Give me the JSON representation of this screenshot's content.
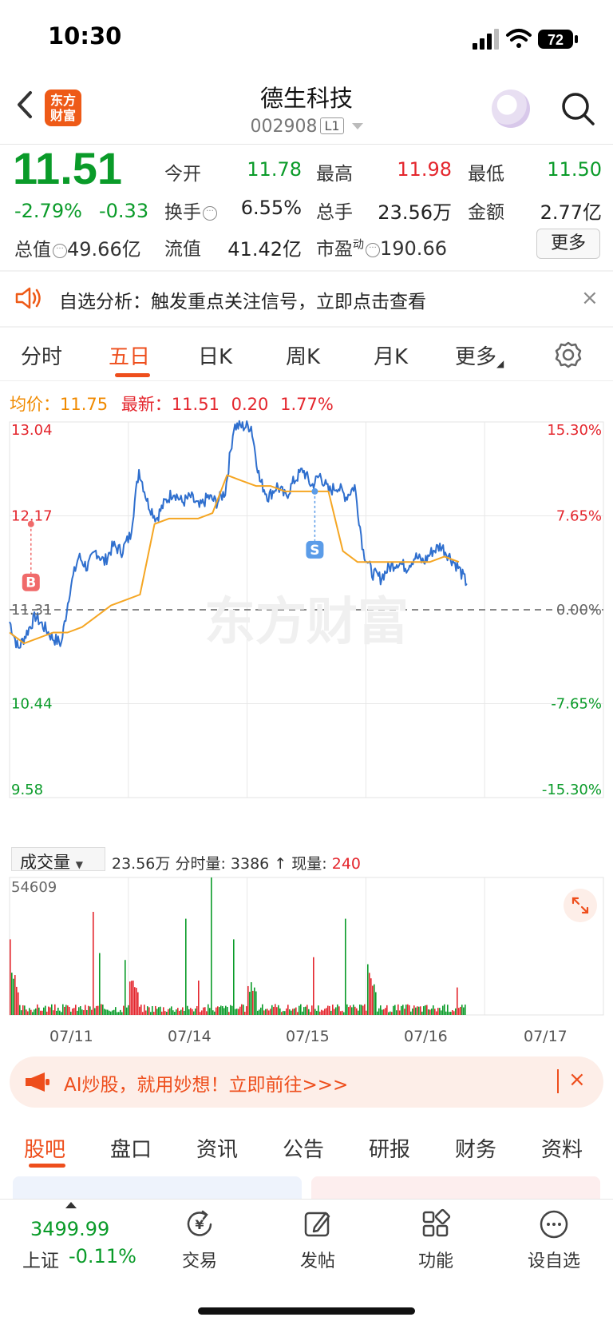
{
  "status": {
    "time": "10:30",
    "battery": "72"
  },
  "header": {
    "logo_line1": "东方",
    "logo_line2": "财富",
    "stock_name": "德生科技",
    "stock_code": "002908",
    "level": "L1"
  },
  "quote": {
    "price": "11.51",
    "chg_pct": "-2.79%",
    "chg_abs": "-0.33",
    "open_label": "今开",
    "open": "11.78",
    "high_label": "最高",
    "high": "11.98",
    "low_label": "最低",
    "low": "11.50",
    "turnover_label": "换手",
    "turnover": "6.55%",
    "volume_label": "总手",
    "volume": "23.56万",
    "amount_label": "金额",
    "amount": "2.77亿",
    "total_mv_label": "总值",
    "total_mv": "49.66亿",
    "float_mv_label": "流值",
    "float_mv": "41.42亿",
    "pe_label": "市盈",
    "pe_sup": "动",
    "pe": "190.66",
    "more": "更多"
  },
  "alert": {
    "text": "自选分析：触发重点关注信号，立即点击查看",
    "close": "×"
  },
  "period_tabs": [
    "分时",
    "五日",
    "日K",
    "周K",
    "月K",
    "更多"
  ],
  "legend": {
    "avg_label": "均价：",
    "avg": "11.75",
    "latest_label": "最新：",
    "latest": "11.51",
    "chg": "0.20",
    "chg_pct": "1.77%"
  },
  "chart_data": [
    {
      "type": "line",
      "title": "",
      "days": [
        "07/11",
        "07/14",
        "07/15",
        "07/16",
        "07/17"
      ],
      "ylim": [
        9.58,
        13.04
      ],
      "y_ticks": [
        "13.04",
        "12.17",
        "11.31",
        "10.44",
        "9.58"
      ],
      "pct_ticks": [
        "15.30%",
        "7.65%",
        "0.00%",
        "-7.65%",
        "-15.30%"
      ],
      "pre_close": 11.31,
      "series": [
        {
          "name": "",
          "values": [
            11.2,
            10.95,
            11.1,
            11.25,
            11.15,
            11.05,
            11.0,
            11.5,
            11.8,
            11.7,
            11.85,
            11.75,
            11.9,
            11.85,
            12.0,
            12.6,
            12.3,
            12.15,
            12.3,
            12.4,
            12.3,
            12.35,
            12.25,
            12.35,
            12.3,
            12.4,
            13.0,
            13.0,
            13.0,
            12.5,
            12.35,
            12.45,
            12.35,
            12.5,
            12.6,
            12.45,
            12.55,
            12.4,
            12.45,
            12.35,
            12.45,
            11.85,
            11.65,
            11.6,
            11.7,
            11.75,
            11.7,
            11.8,
            11.75,
            11.85,
            11.9,
            11.8,
            11.7,
            11.55
          ]
        },
        {
          "name": "",
          "values": [
            11.1,
            11.0,
            11.05,
            11.1,
            11.1,
            11.15,
            11.25,
            11.35,
            11.4,
            11.45,
            12.1,
            12.15,
            12.15,
            12.15,
            12.2,
            12.55,
            12.5,
            12.45,
            12.45,
            12.4,
            12.4,
            12.4,
            12.4,
            11.85,
            11.75,
            11.75,
            11.75,
            11.75,
            11.75,
            11.75,
            11.8,
            11.75
          ]
        }
      ],
      "markers": [
        {
          "label": "B",
          "day": "07/11",
          "price": 12.1
        },
        {
          "label": "S",
          "day": "07/15",
          "price": 12.4
        }
      ]
    },
    {
      "type": "bar",
      "title": "",
      "ymax": 54609,
      "volume_label": "成交量",
      "summary": {
        "total": "23.56万",
        "minute_label": "分时量:",
        "minute": "3386",
        "arrow": "↑",
        "current_label": "现量:",
        "current": "240"
      }
    }
  ],
  "date_labels": [
    "07/11",
    "07/14",
    "07/15",
    "07/16",
    "07/17"
  ],
  "ai_banner": {
    "text": "AI炒股，就用妙想！立即前往>>>",
    "close": "×"
  },
  "content_tabs": [
    "股吧",
    "盘口",
    "资讯",
    "公告",
    "研报",
    "财务",
    "资料"
  ],
  "tabbar": {
    "index_value": "3499.99",
    "index_name": "上证",
    "index_chg": "-0.11%",
    "items": [
      "交易",
      "发帖",
      "功能",
      "设自选"
    ]
  },
  "watermark": "东方财富",
  "colors": {
    "up": "#e4262d",
    "down": "#0a9b29",
    "price_line": "#2f6fce",
    "avg_line": "#f5a623",
    "accent": "#ee4e1c"
  }
}
